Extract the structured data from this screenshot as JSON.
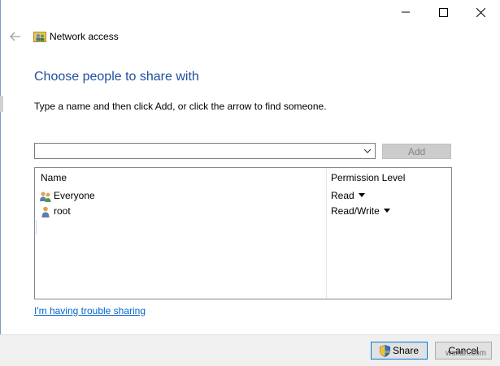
{
  "window": {
    "title": "Network access",
    "minimize_icon": "minimize-icon",
    "maximize_icon": "maximize-icon",
    "close_icon": "close-icon"
  },
  "header": {
    "heading": "Choose people to share with",
    "instructions": "Type a name and then click Add, or click the arrow to find someone."
  },
  "picker": {
    "value": "",
    "add_label": "Add"
  },
  "list": {
    "columns": {
      "name": "Name",
      "permission": "Permission Level"
    },
    "rows": [
      {
        "name": "Everyone",
        "permission": "Read",
        "icon": "users-group-icon"
      },
      {
        "name": "root",
        "permission": "Read/Write",
        "icon": "user-icon"
      }
    ]
  },
  "links": {
    "trouble": "I'm having trouble sharing"
  },
  "footer": {
    "share_label": "Share",
    "cancel_label": "Cancel"
  },
  "watermark": "wsxdn.com",
  "colors": {
    "heading": "#1f4fa0",
    "link": "#0066cc",
    "focus_border": "#0078d7"
  }
}
